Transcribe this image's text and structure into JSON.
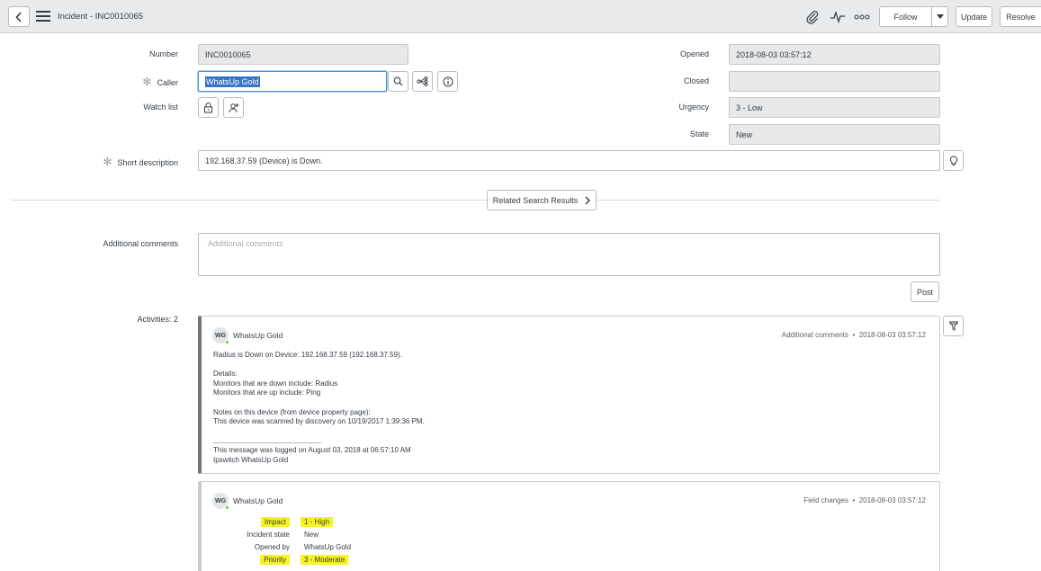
{
  "header": {
    "title": "Incident - INC0010065",
    "follow_label": "Follow",
    "update_label": "Update",
    "resolve_label": "Resolve",
    "icons": [
      "chevron-left-icon",
      "hamburger-menu-icon",
      "paperclip-icon",
      "activity-pulse-icon",
      "more-options-icon",
      "caret-down-icon"
    ]
  },
  "form": {
    "number": {
      "label": "Number",
      "value": "INC0010065"
    },
    "caller": {
      "label": "Caller",
      "value": "WhatsUp Gold"
    },
    "watch_list": {
      "label": "Watch list"
    },
    "short_description": {
      "label": "Short description",
      "value": "192.168.37.59 (Device) is Down."
    },
    "opened": {
      "label": "Opened",
      "value": "2018-08-03 03:57:12"
    },
    "closed": {
      "label": "Closed",
      "value": ""
    },
    "urgency": {
      "label": "Urgency",
      "value": "3 - Low"
    },
    "state": {
      "label": "State",
      "value": "New"
    }
  },
  "related_search": {
    "label": "Related Search Results"
  },
  "comments": {
    "label": "Additional comments",
    "placeholder": "Additional comments",
    "post_label": "Post"
  },
  "activities": {
    "label": "Activities: 2",
    "entries": [
      {
        "initials": "WG",
        "author": "WhatsUp Gold",
        "type": "Additional comments",
        "timestamp": "2018-08-03 03:57:12",
        "lines": [
          "Radius is Down on Device: 192.168.37.59 (192.168.37.59).",
          "",
          "Details:",
          "Monitors that are down include: Radius",
          "Monitors that are up include: Ping",
          "",
          "Notes on this device (from device property page):",
          "This device was scanned by discovery on 10/19/2017 1:39:36 PM.",
          "",
          "____________________________________",
          "This message was logged on August 03, 2018 at 06:57:10 AM",
          "Ipswitch WhatsUp Gold"
        ]
      },
      {
        "initials": "WG",
        "author": "WhatsUp Gold",
        "type": "Field changes",
        "timestamp": "2018-08-03 03:57:12",
        "changes": [
          {
            "field": "Impact",
            "value": "1 - High",
            "highlight": true
          },
          {
            "field": "Incident state",
            "value": "New",
            "highlight": false
          },
          {
            "field": "Opened by",
            "value": "WhatsUp Gold",
            "highlight": false
          },
          {
            "field": "Priority",
            "value": "3 - Moderate",
            "highlight": true
          }
        ]
      }
    ]
  },
  "colors": {
    "header_bg": "#e8eaec",
    "selection": "#3a74c8",
    "highlight": "#f6f320",
    "presence": "#71c04a"
  }
}
